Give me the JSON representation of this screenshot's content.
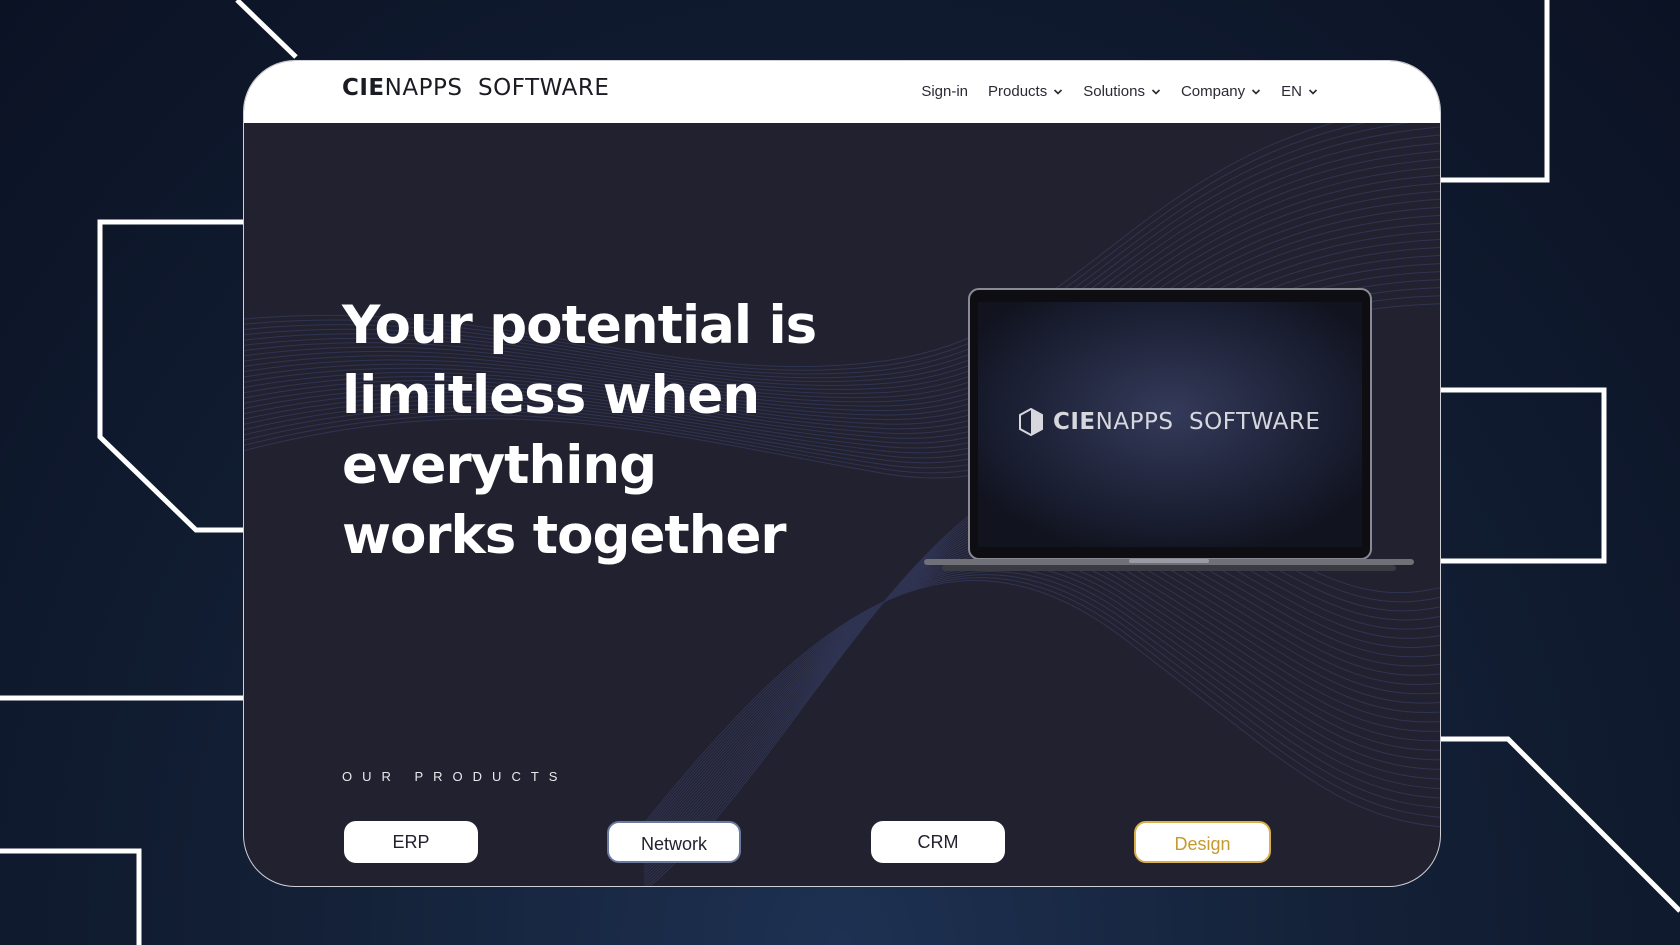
{
  "header": {
    "logo_bold": "CIE",
    "logo_light": "NAPPS  SOFTWARE"
  },
  "nav": [
    {
      "label": "Sign-in",
      "dropdown": false
    },
    {
      "label": "Products",
      "dropdown": true
    },
    {
      "label": "Solutions",
      "dropdown": true
    },
    {
      "label": "Company",
      "dropdown": true
    },
    {
      "label": "EN",
      "dropdown": true
    }
  ],
  "hero": {
    "lines": [
      "Your potential is",
      "limitless when",
      "everything",
      "works together"
    ]
  },
  "laptop_screen": {
    "logo_bold": "CIE",
    "logo_light": "NAPPS  SOFTWARE",
    "icon": "cube-logo-icon"
  },
  "products": {
    "label": "OUR PRODUCTS",
    "items": [
      {
        "label": "ERP",
        "state": "default"
      },
      {
        "label": "Network",
        "state": "outlined"
      },
      {
        "label": "CRM",
        "state": "default"
      },
      {
        "label": "Design",
        "state": "active"
      }
    ]
  },
  "colors": {
    "background": "#0b1224",
    "card": "#22212f",
    "accent_gold": "#d9b04a",
    "white": "#ffffff"
  }
}
